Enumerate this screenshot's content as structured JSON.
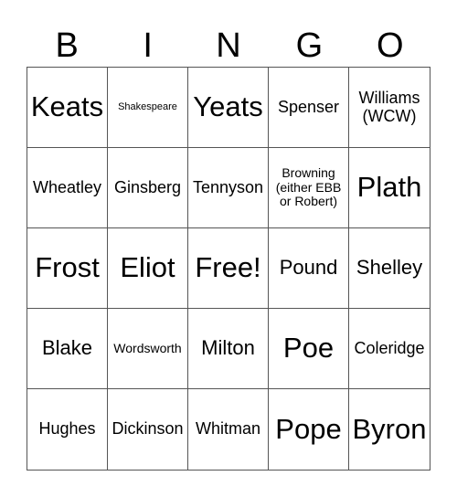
{
  "header": [
    "B",
    "I",
    "N",
    "G",
    "O"
  ],
  "cells": [
    {
      "text": "Keats",
      "size": "s-xl"
    },
    {
      "text": "Shakespeare",
      "size": "s-xs"
    },
    {
      "text": "Yeats",
      "size": "s-xl"
    },
    {
      "text": "Spenser",
      "size": "s-m"
    },
    {
      "text": "Williams (WCW)",
      "size": "s-m"
    },
    {
      "text": "Wheatley",
      "size": "s-m"
    },
    {
      "text": "Ginsberg",
      "size": "s-m"
    },
    {
      "text": "Tennyson",
      "size": "s-m"
    },
    {
      "text": "Browning (either EBB or Robert)",
      "size": "s-s"
    },
    {
      "text": "Plath",
      "size": "s-xl"
    },
    {
      "text": "Frost",
      "size": "s-xl"
    },
    {
      "text": "Eliot",
      "size": "s-xl"
    },
    {
      "text": "Free!",
      "size": "s-xl"
    },
    {
      "text": "Pound",
      "size": "s-l"
    },
    {
      "text": "Shelley",
      "size": "s-l"
    },
    {
      "text": "Blake",
      "size": "s-l"
    },
    {
      "text": "Wordsworth",
      "size": "s-s"
    },
    {
      "text": "Milton",
      "size": "s-l"
    },
    {
      "text": "Poe",
      "size": "s-xl"
    },
    {
      "text": "Coleridge",
      "size": "s-m"
    },
    {
      "text": "Hughes",
      "size": "s-m"
    },
    {
      "text": "Dickinson",
      "size": "s-m"
    },
    {
      "text": "Whitman",
      "size": "s-m"
    },
    {
      "text": "Pope",
      "size": "s-xl"
    },
    {
      "text": "Byron",
      "size": "s-xl"
    }
  ]
}
